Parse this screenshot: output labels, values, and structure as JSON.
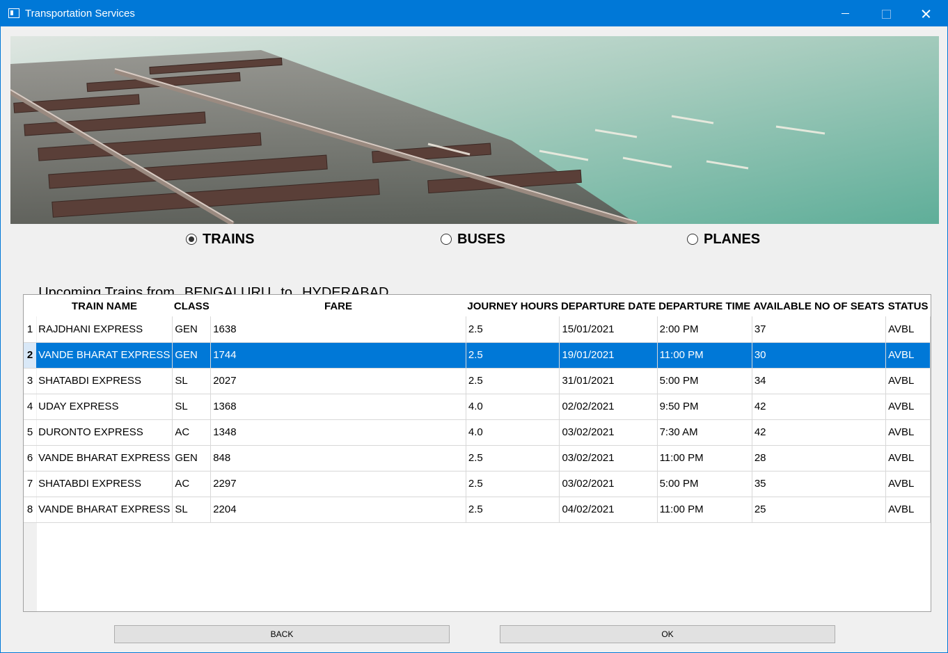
{
  "window": {
    "title": "Transportation Services"
  },
  "modes": [
    {
      "label": "TRAINS",
      "checked": true
    },
    {
      "label": "BUSES",
      "checked": false
    },
    {
      "label": "PLANES",
      "checked": false
    }
  ],
  "heading": {
    "prefix": "Upcoming Trains from",
    "from": "BENGALURU",
    "to_word": "to",
    "to": "HYDERABAD"
  },
  "table": {
    "columns": [
      "TRAIN NAME",
      "CLASS",
      "FARE",
      "JOURNEY HOURS",
      "DEPARTURE DATE",
      "DEPARTURE TIME",
      "AVAILABLE NO OF SEATS",
      "STATUS"
    ],
    "selected_row": 2,
    "rows": [
      {
        "n": "1",
        "cells": [
          "RAJDHANI EXPRESS",
          "GEN",
          "1638",
          "2.5",
          "15/01/2021",
          "2:00 PM",
          "37",
          "AVBL"
        ]
      },
      {
        "n": "2",
        "cells": [
          "VANDE BHARAT EXPRESS",
          "GEN",
          "1744",
          "2.5",
          "19/01/2021",
          "11:00 PM",
          "30",
          "AVBL"
        ]
      },
      {
        "n": "3",
        "cells": [
          "SHATABDI EXPRESS",
          "SL",
          "2027",
          "2.5",
          "31/01/2021",
          "5:00 PM",
          "34",
          "AVBL"
        ]
      },
      {
        "n": "4",
        "cells": [
          "UDAY EXPRESS",
          "SL",
          "1368",
          "4.0",
          "02/02/2021",
          "9:50 PM",
          "42",
          "AVBL"
        ]
      },
      {
        "n": "5",
        "cells": [
          "DURONTO EXPRESS",
          "AC",
          "1348",
          "4.0",
          "03/02/2021",
          "7:30 AM",
          "42",
          "AVBL"
        ]
      },
      {
        "n": "6",
        "cells": [
          "VANDE BHARAT EXPRESS",
          "GEN",
          "848",
          "2.5",
          "03/02/2021",
          "11:00 PM",
          "28",
          "AVBL"
        ]
      },
      {
        "n": "7",
        "cells": [
          "SHATABDI EXPRESS",
          "AC",
          "2297",
          "2.5",
          "03/02/2021",
          "5:00 PM",
          "35",
          "AVBL"
        ]
      },
      {
        "n": "8",
        "cells": [
          "VANDE BHARAT EXPRESS",
          "SL",
          "2204",
          "2.5",
          "04/02/2021",
          "11:00 PM",
          "25",
          "AVBL"
        ]
      }
    ]
  },
  "buttons": {
    "back": "BACK",
    "ok": "OK"
  },
  "colors": {
    "titlebar": "#0078d7",
    "selection": "#0078d7",
    "window_bg": "#f0f0f0"
  },
  "banner": {
    "icon": "railway-track-photo"
  }
}
